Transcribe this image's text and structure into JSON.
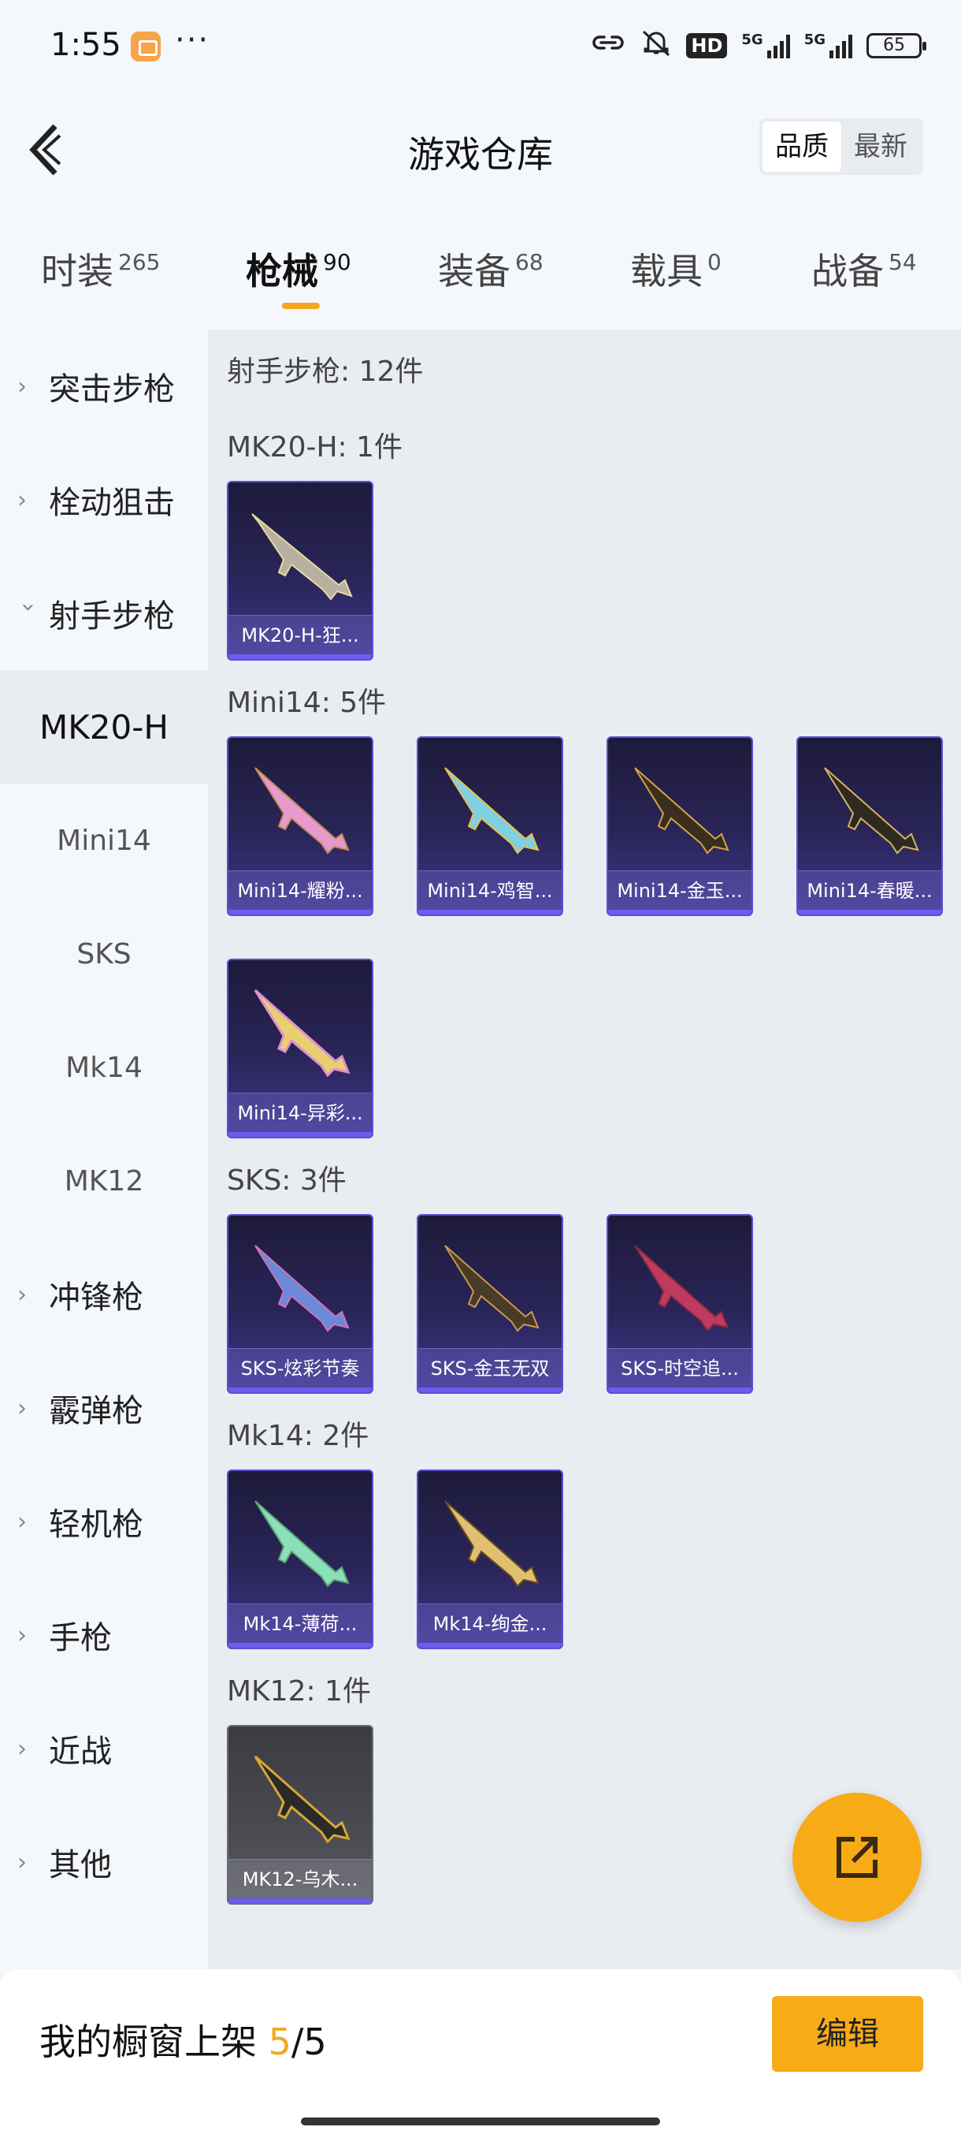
{
  "status_bar": {
    "time": "1:55",
    "dots": "···",
    "hd": "HD",
    "network1": "5G",
    "network2": "5G",
    "battery": "65"
  },
  "header": {
    "title": "游戏仓库",
    "sort_options": [
      "品质",
      "最新"
    ],
    "active_sort": "品质"
  },
  "tabs": [
    {
      "label": "时装",
      "count": "265"
    },
    {
      "label": "枪械",
      "count": "90",
      "active": true
    },
    {
      "label": "装备",
      "count": "68"
    },
    {
      "label": "载具",
      "count": "0"
    },
    {
      "label": "战备",
      "count": "54"
    }
  ],
  "sidebar": {
    "categories_top": [
      "突击步枪",
      "栓动狙击",
      "射手步枪"
    ],
    "subcategories": [
      "MK20-H",
      "Mini14",
      "SKS",
      "Mk14",
      "MK12"
    ],
    "active_sub": "MK20-H",
    "categories_bottom": [
      "冲锋枪",
      "霰弹枪",
      "轻机枪",
      "手枪",
      "近战",
      "其他"
    ]
  },
  "main": {
    "group_title": "射手步枪: 12件",
    "sections": [
      {
        "title": "MK20-H: 1件",
        "items": [
          "MK20-H-狂..."
        ]
      },
      {
        "title": "Mini14: 5件",
        "items": [
          "Mini14-耀粉...",
          "Mini14-鸡智...",
          "Mini14-金玉...",
          "Mini14-春暖...",
          "Mini14-异彩..."
        ]
      },
      {
        "title": "SKS: 3件",
        "items": [
          "SKS-炫彩节奏",
          "SKS-金玉无双",
          "SKS-时空追..."
        ]
      },
      {
        "title": "Mk14: 2件",
        "items": [
          "Mk14-薄荷...",
          "Mk14-绚金..."
        ]
      },
      {
        "title": "MK12: 1件",
        "items": [
          "MK12-乌木..."
        ]
      }
    ]
  },
  "bottom": {
    "shelf_label": "我的橱窗上架",
    "shelf_current": "5",
    "shelf_sep": "/",
    "shelf_total": "5",
    "edit_label": "编辑"
  },
  "colors": {
    "accent": "#f7ab17",
    "card_border": "#5a4fd6",
    "card_bg": "#2a2558"
  },
  "icons": [
    "back-arrow-icon",
    "share-external-icon",
    "gun-icon"
  ]
}
